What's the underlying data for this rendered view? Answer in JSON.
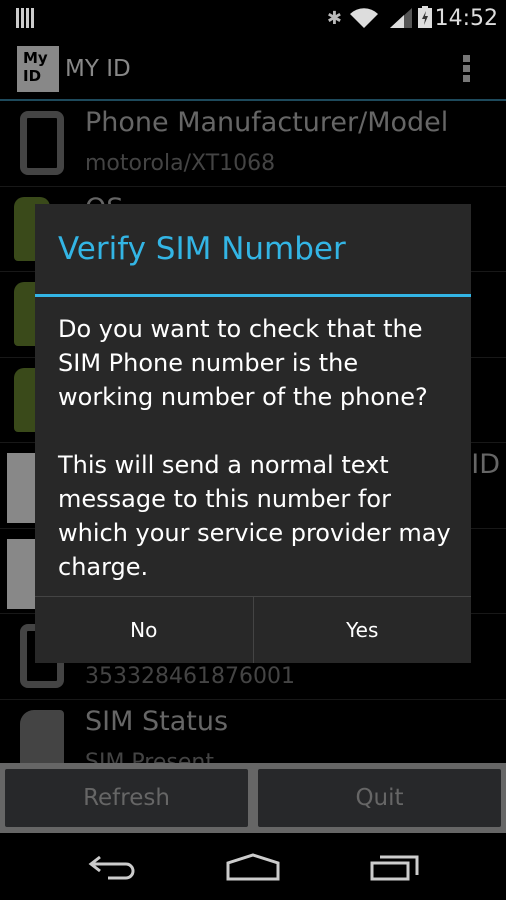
{
  "status_bar": {
    "time": "14:52",
    "icons": [
      "notification-icon",
      "bluetooth-icon",
      "wifi-icon",
      "signal-icon",
      "battery-charging-icon"
    ]
  },
  "action_bar": {
    "logo_text": [
      "My",
      "ID"
    ],
    "title": "MY ID",
    "menu_icon": "overflow-menu-icon"
  },
  "list": {
    "items": [
      {
        "title": "Phone Manufacturer/Model",
        "value": "motorola/XT1068",
        "icon": "phone-icon"
      },
      {
        "title": "OS",
        "value": "",
        "icon": "android-icon"
      },
      {
        "title": "",
        "value": "",
        "icon": "android-icon"
      },
      {
        "title": "",
        "value": "",
        "icon": "android-icon"
      },
      {
        "title": "",
        "title_right": "ID",
        "value": "",
        "icon": "image-icon"
      },
      {
        "title": "",
        "value": "",
        "icon": "wifi-image-icon"
      },
      {
        "title": "",
        "value": "353328461876001",
        "icon": "phone-icon"
      },
      {
        "title": "SIM Status",
        "value": "SIM Present",
        "icon": "sim-card-icon"
      }
    ]
  },
  "bottom_buttons": {
    "refresh": "Refresh",
    "quit": "Quit"
  },
  "dialog": {
    "title": "Verify SIM Number",
    "paragraphs": [
      "Do you want to check that the SIM Phone number is the working number of the phone?",
      "This will send a normal text message to this number for which your service provider may charge."
    ],
    "no": "No",
    "yes": "Yes"
  },
  "colors": {
    "accent": "#33b5e5"
  }
}
